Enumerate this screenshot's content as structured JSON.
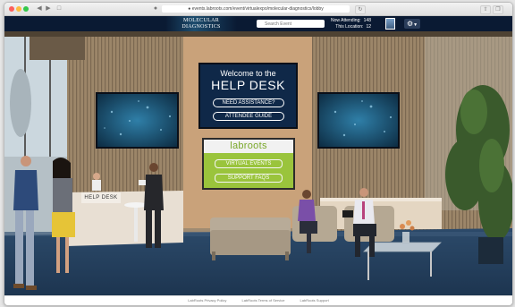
{
  "browser": {
    "url": "● events.labroots.com/event/virtualexpo/molecular-diagnostics/lobby"
  },
  "header": {
    "logo_text": "MOLECULAR DIAGNOSTICS",
    "search_placeholder": "Search Event",
    "stats": [
      {
        "label": "Now Attending:",
        "value": "148"
      },
      {
        "label": "This Location:",
        "value": "12"
      }
    ],
    "colors": {
      "bar": "#0a1a33",
      "accent": "#9ac43c"
    }
  },
  "help_desk": {
    "welcome": "Welcome to the",
    "title": "HELP DESK",
    "buttons": [
      "NEED ASSISTANCE?",
      "ATTENDEE GUIDE"
    ]
  },
  "labroots": {
    "logo": "labroots",
    "buttons": [
      "VIRTUAL EVENTS",
      "SUPPORT FAQS"
    ]
  },
  "desk_label": "HELP DESK",
  "footer": {
    "links": [
      "LabRoots Privacy Policy",
      "LabRoots Terms of Service",
      "LabRoots Support"
    ]
  }
}
